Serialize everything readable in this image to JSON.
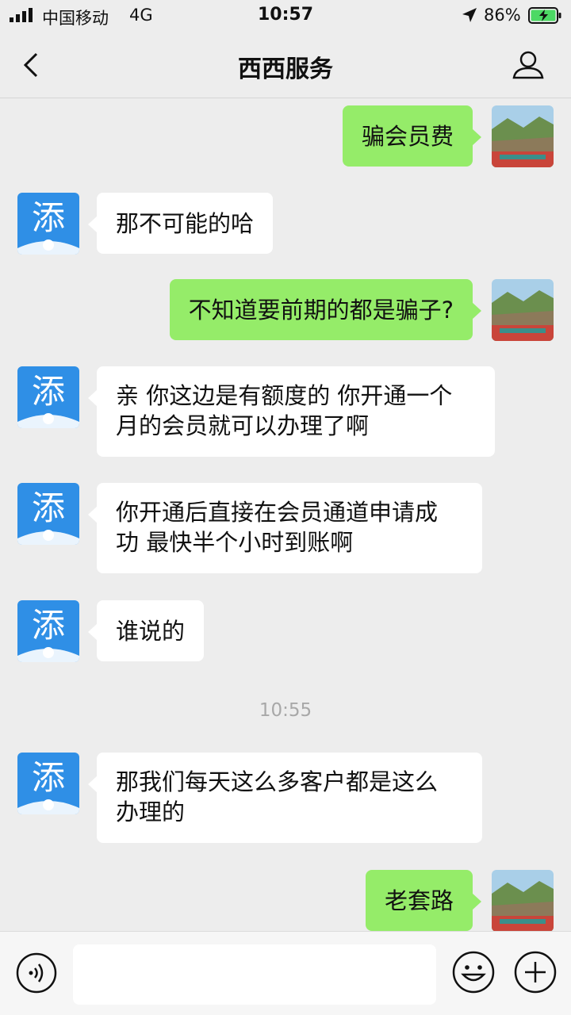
{
  "status_bar": {
    "carrier": "中国移动",
    "network": "4G",
    "time": "10:57",
    "battery_percent": "86%"
  },
  "nav": {
    "title": "西西服务"
  },
  "messages": [
    {
      "from": "me",
      "text": "骗会员费"
    },
    {
      "from": "service",
      "text": "那不可能的哈",
      "avatar_char": "添"
    },
    {
      "from": "me",
      "text": "不知道要前期的都是骗子?"
    },
    {
      "from": "service",
      "line1": "亲 你这边是有额度的 你开通一个",
      "line2": "月的会员就可以办理了啊",
      "avatar_char": "添"
    },
    {
      "from": "service",
      "line1": "你开通后直接在会员通道申请成",
      "line2": "功 最快半个小时到账啊",
      "avatar_char": "添"
    },
    {
      "from": "service",
      "text": "谁说的",
      "avatar_char": "添"
    },
    {
      "from": "service",
      "line1": "那我们每天这么多客户都是这么",
      "line2": "办理的",
      "avatar_char": "添"
    },
    {
      "from": "me",
      "text": "老套路"
    }
  ],
  "timestamp": "10:55",
  "colors": {
    "background": "#ededed",
    "outgoing_bubble": "#95ec69",
    "incoming_bubble": "#ffffff",
    "service_avatar": "#2f8fe6"
  },
  "icons": [
    "back-icon",
    "profile-icon",
    "voice-icon",
    "emoji-icon",
    "plus-icon"
  ]
}
